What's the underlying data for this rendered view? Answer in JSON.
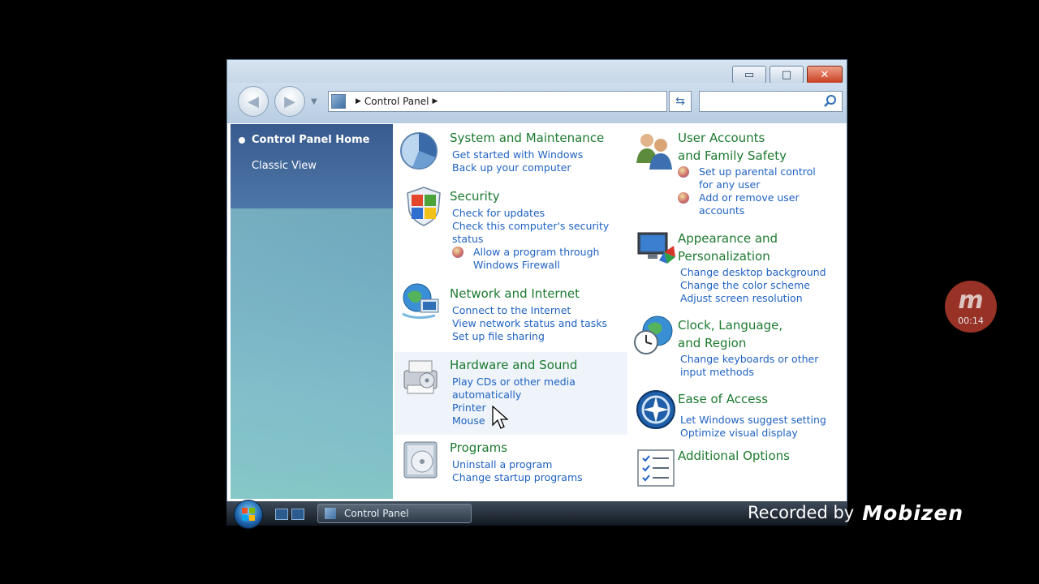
{
  "window": {
    "controls": {
      "minimize": "▭",
      "maximize": "□",
      "close": "✕"
    },
    "navbar": {
      "back": "◀",
      "forward": "▶",
      "breadcrumb": [
        "Control Panel"
      ],
      "search_placeholder": ""
    }
  },
  "sidebar": {
    "items": [
      {
        "label": "Control Panel Home",
        "active": true
      },
      {
        "label": "Classic View",
        "active": false
      }
    ]
  },
  "categories_left": [
    {
      "title": "System and Maintenance",
      "icon": "system-maintenance-icon",
      "links": [
        "Get started with Windows",
        "Back up your computer"
      ]
    },
    {
      "title": "Security",
      "icon": "security-shield-icon",
      "links": [
        "Check for updates",
        "Check this computer's security",
        "status"
      ],
      "shield_links": [
        "Allow a program through",
        "Windows Firewall"
      ]
    },
    {
      "title": "Network and Internet",
      "icon": "network-globe-icon",
      "links": [
        "Connect to the Internet",
        "View network status and tasks",
        "Set up file sharing"
      ]
    },
    {
      "title": "Hardware and Sound",
      "icon": "hardware-printer-icon",
      "links": [
        "Play CDs or other media",
        "automatically",
        "Printer",
        "Mouse"
      ]
    },
    {
      "title": "Programs",
      "icon": "programs-disc-icon",
      "links": [
        "Uninstall a program",
        "Change startup programs"
      ]
    }
  ],
  "categories_right": [
    {
      "title_lines": [
        "User Accounts",
        "and Family Safety"
      ],
      "icon": "user-accounts-icon",
      "shield_links": [
        [
          "Set up parental control",
          "for any user"
        ],
        [
          "Add or remove user",
          "accounts"
        ]
      ]
    },
    {
      "title_lines": [
        "Appearance and",
        "Personalization"
      ],
      "icon": "appearance-monitor-icon",
      "links": [
        "Change desktop background",
        "Change the color scheme",
        "Adjust screen resolution"
      ]
    },
    {
      "title_lines": [
        "Clock, Language,",
        "and Region"
      ],
      "icon": "clock-globe-icon",
      "links": [
        "Change keyboards or other",
        "input methods"
      ]
    },
    {
      "title_lines": [
        "Ease of Access"
      ],
      "icon": "ease-of-access-icon",
      "links": [
        "Let Windows suggest setting",
        "Optimize visual display"
      ]
    },
    {
      "title_lines": [
        "Additional Options"
      ],
      "icon": "additional-options-icon",
      "links": []
    }
  ],
  "taskbar": {
    "task_label": "Control Panel"
  },
  "overlay": {
    "badge_logo": "m",
    "timer": "00:14",
    "recorded_by": "Recorded by",
    "brand": "Mobizen"
  },
  "colors": {
    "title_green": "#1c7a2f",
    "link_blue": "#1f62c2",
    "sidebar_blue": "#385b8e"
  }
}
